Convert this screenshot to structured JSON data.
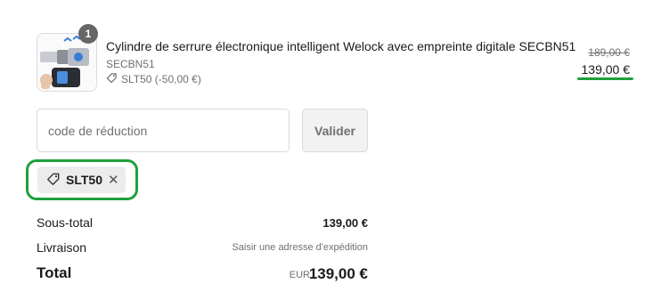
{
  "product": {
    "title": "Cylindre de serrure électronique intelligent Welock avec empreinte digitale SECBN51",
    "sku": "SECBN51",
    "discount_line": "SLT50 (-50,00 €)",
    "quantity": "1",
    "price_original": "189,00 €",
    "price_final": "139,00 €",
    "image_icon": "smart-lock-cylinder-image"
  },
  "discount_form": {
    "placeholder": "code de réduction",
    "value": "",
    "apply_label": "Valider"
  },
  "applied_code": {
    "code": "SLT50",
    "icon": "tag-icon",
    "remove_icon": "close-icon"
  },
  "totals": {
    "subtotal_label": "Sous-total",
    "subtotal_value": "139,00 €",
    "shipping_label": "Livraison",
    "shipping_value": "Saisir une adresse d'expédition",
    "total_label": "Total",
    "currency": "EUR",
    "total_value": "139,00 €"
  },
  "colors": {
    "highlight": "#1ea03c",
    "badge": "#666666",
    "chip_bg": "#ececec"
  }
}
